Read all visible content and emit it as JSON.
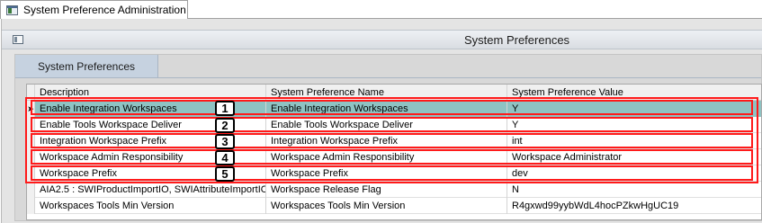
{
  "window": {
    "tab_title": "System Preference Administration"
  },
  "panel": {
    "title": "System Preferences"
  },
  "tabs": [
    {
      "label": "System Preferences"
    }
  ],
  "grid": {
    "columns": [
      "Description",
      "System Preference Name",
      "System Preference Value"
    ],
    "rows": [
      {
        "selector": "➤",
        "desc": "Enable Integration Workspaces",
        "name": "Enable Integration Workspaces",
        "value": "Y"
      },
      {
        "selector": "",
        "desc": "Enable Tools Workspace Deliver",
        "name": "Enable Tools Workspace Deliver",
        "value": "Y"
      },
      {
        "selector": "",
        "desc": "Integration Workspace Prefix",
        "name": "Integration Workspace Prefix",
        "value": "int"
      },
      {
        "selector": "",
        "desc": "Workspace Admin Responsibility",
        "name": "Workspace Admin Responsibility",
        "value": "Workspace Administrator"
      },
      {
        "selector": "",
        "desc": "Workspace Prefix",
        "name": "Workspace Prefix",
        "value": "dev"
      },
      {
        "selector": "",
        "desc": "AIA2.5 : SWIProductImportIO, SWIAttributeImportIO",
        "name": "Workspace Release Flag",
        "value": "N"
      },
      {
        "selector": "",
        "desc": "Workspaces Tools Min Version",
        "name": "Workspaces Tools Min Version",
        "value": "R4gxwd99yybWdL4hocPZkwHgUC19"
      }
    ]
  },
  "annotations": [
    "1",
    "2",
    "3",
    "4",
    "5"
  ],
  "colors": {
    "selected_row": "#8ec3c3",
    "highlight": "#ff1a1a",
    "tab": "#c6d2e0"
  }
}
